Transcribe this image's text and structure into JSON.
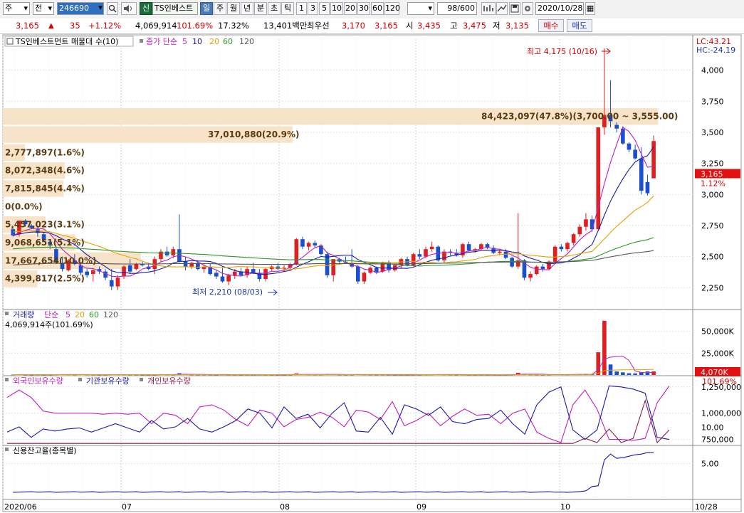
{
  "toolbar": {
    "market": "주",
    "adjust": "전",
    "code": "246690",
    "badge": "신",
    "name": "TS인베스트",
    "periods": [
      "일",
      "주",
      "월",
      "년",
      "분",
      "초",
      "틱"
    ],
    "active_period": "일",
    "counts": [
      "1",
      "3",
      "5",
      "10",
      "20",
      "30",
      "60",
      "120"
    ],
    "view": "98/600",
    "date": "2020/10/28"
  },
  "infobar": {
    "price": "3,165",
    "change": "35",
    "change_pct": "+1.12%",
    "volume": "4,069,914",
    "vol_ratio": "101.69%",
    "turnover": "17.32%",
    "amount": "13,401백만",
    "pref_label": "최우선",
    "ask": "3,170",
    "bid": "3,165",
    "open_label": "시",
    "open": "3,435",
    "high_label": "고",
    "high": "3,475",
    "low_label": "저",
    "low": "3,135",
    "buy_label": "매수",
    "sell_label": "매도"
  },
  "chart_data": {
    "type": "candlestick",
    "dates": [
      "2020/06",
      "07",
      "08",
      "09",
      "10",
      "10/28"
    ],
    "price": {
      "title": "TS인베스트먼트 매물대 수(10)",
      "ma_title": "종가 단순",
      "ma_periods": [
        "5",
        "10",
        "20",
        "60",
        "120"
      ],
      "ma_colors": [
        "#c020c0",
        "#1a1aa8",
        "#e8a000",
        "#2a9a2a",
        "#555555"
      ],
      "ylim": [
        2080,
        4250
      ],
      "yticks": [
        2250,
        2500,
        2750,
        3000,
        3250,
        3500,
        3750,
        4000
      ],
      "ytick_labels": [
        "2,250",
        "2,500",
        "2,750",
        "3,000",
        "3,250",
        "3,500",
        "3,750",
        "4,000"
      ],
      "lc": "LC:43.21",
      "hc": "HC:-24.19",
      "last_price": "3,165",
      "last_pct": "1.12%",
      "high_note": "최고 4,175 (10/16)",
      "low_note": "최저 2,210 (08/03)",
      "volume_profile": [
        {
          "label": "84,423,097(47.8%)(3,700.00 ~ 3,555.00)",
          "lo": 3555,
          "hi": 3700,
          "frac": 0.95
        },
        {
          "label": "37,010,880(20.9%)",
          "lo": 3410,
          "hi": 3555,
          "frac": 0.42
        },
        {
          "label": "2,777,897(1.6%)",
          "lo": 3265,
          "hi": 3410,
          "frac": 0.032
        },
        {
          "label": "8,072,348(4.6%)",
          "lo": 3120,
          "hi": 3265,
          "frac": 0.09
        },
        {
          "label": "7,815,845(4.4%)",
          "lo": 2975,
          "hi": 3120,
          "frac": 0.088
        },
        {
          "label": "0(0.0%)",
          "lo": 2830,
          "hi": 2975,
          "frac": 0.0
        },
        {
          "label": "5,457,023(3.1%)",
          "lo": 2685,
          "hi": 2830,
          "frac": 0.062
        },
        {
          "label": "9,068,651(5.1%)",
          "lo": 2540,
          "hi": 2685,
          "frac": 0.105
        },
        {
          "label": "17,667,654(10.0%)",
          "lo": 2395,
          "hi": 2540,
          "frac": 0.2
        },
        {
          "label": "4,399,817(2.5%)",
          "lo": 2250,
          "hi": 2395,
          "frac": 0.05
        }
      ],
      "candles": [
        [
          2720,
          2730,
          2660,
          2670
        ],
        [
          2680,
          2790,
          2660,
          2790
        ],
        [
          2790,
          2800,
          2740,
          2760
        ],
        [
          2750,
          2760,
          2720,
          2730
        ],
        [
          2720,
          2740,
          2660,
          2690
        ],
        [
          2680,
          2690,
          2620,
          2640
        ],
        [
          2620,
          2640,
          2560,
          2600
        ],
        [
          2560,
          2580,
          2440,
          2460
        ],
        [
          2450,
          2500,
          2380,
          2400
        ],
        [
          2390,
          2480,
          2380,
          2470
        ],
        [
          2470,
          2520,
          2430,
          2440
        ],
        [
          2430,
          2450,
          2350,
          2370
        ],
        [
          2380,
          2400,
          2330,
          2350
        ],
        [
          2360,
          2400,
          2300,
          2390
        ],
        [
          2400,
          2420,
          2360,
          2380
        ],
        [
          2380,
          2400,
          2310,
          2330
        ],
        [
          2310,
          2400,
          2230,
          2260
        ],
        [
          2260,
          2350,
          2230,
          2330
        ],
        [
          2340,
          2430,
          2320,
          2420
        ],
        [
          2430,
          2480,
          2360,
          2380
        ],
        [
          2400,
          2450,
          2390,
          2440
        ],
        [
          2440,
          2460,
          2420,
          2430
        ],
        [
          2420,
          2450,
          2390,
          2400
        ],
        [
          2400,
          2500,
          2360,
          2480
        ],
        [
          2480,
          2560,
          2460,
          2540
        ],
        [
          2540,
          2580,
          2500,
          2510
        ],
        [
          2510,
          2580,
          2490,
          2560
        ],
        [
          2560,
          2840,
          2450,
          2460
        ],
        [
          2460,
          2500,
          2390,
          2420
        ],
        [
          2420,
          2460,
          2400,
          2450
        ],
        [
          2450,
          2470,
          2390,
          2400
        ],
        [
          2400,
          2440,
          2370,
          2420
        ],
        [
          2420,
          2440,
          2350,
          2360
        ],
        [
          2370,
          2390,
          2320,
          2340
        ],
        [
          2340,
          2410,
          2290,
          2300
        ],
        [
          2300,
          2360,
          2270,
          2350
        ],
        [
          2350,
          2400,
          2320,
          2380
        ],
        [
          2380,
          2410,
          2340,
          2350
        ],
        [
          2350,
          2420,
          2330,
          2400
        ],
        [
          2400,
          2450,
          2360,
          2370
        ],
        [
          2370,
          2400,
          2300,
          2320
        ],
        [
          2320,
          2410,
          2300,
          2400
        ],
        [
          2400,
          2430,
          2380,
          2420
        ],
        [
          2420,
          2450,
          2390,
          2400
        ],
        [
          2400,
          2430,
          2380,
          2410
        ],
        [
          2410,
          2450,
          2390,
          2440
        ],
        [
          2440,
          2650,
          2430,
          2640
        ],
        [
          2640,
          2660,
          2560,
          2580
        ],
        [
          2580,
          2620,
          2550,
          2610
        ],
        [
          2610,
          2630,
          2570,
          2590
        ],
        [
          2590,
          2600,
          2510,
          2520
        ],
        [
          2520,
          2540,
          2330,
          2350
        ],
        [
          2350,
          2480,
          2300,
          2480
        ],
        [
          2480,
          2490,
          2440,
          2460
        ],
        [
          2460,
          2500,
          2440,
          2450
        ],
        [
          2450,
          2560,
          2410,
          2420
        ],
        [
          2420,
          2430,
          2280,
          2300
        ],
        [
          2300,
          2380,
          2280,
          2370
        ],
        [
          2370,
          2420,
          2360,
          2410
        ],
        [
          2410,
          2420,
          2360,
          2370
        ],
        [
          2380,
          2460,
          2370,
          2450
        ],
        [
          2450,
          2470,
          2370,
          2390
        ],
        [
          2390,
          2440,
          2380,
          2430
        ],
        [
          2430,
          2490,
          2410,
          2480
        ],
        [
          2480,
          2500,
          2420,
          2430
        ],
        [
          2430,
          2530,
          2420,
          2520
        ],
        [
          2520,
          2560,
          2480,
          2500
        ],
        [
          2500,
          2580,
          2490,
          2560
        ],
        [
          2560,
          2620,
          2540,
          2580
        ],
        [
          2580,
          2590,
          2460,
          2470
        ],
        [
          2470,
          2560,
          2450,
          2540
        ],
        [
          2540,
          2560,
          2510,
          2530
        ],
        [
          2530,
          2560,
          2500,
          2510
        ],
        [
          2510,
          2610,
          2490,
          2600
        ],
        [
          2600,
          2620,
          2540,
          2550
        ],
        [
          2550,
          2570,
          2530,
          2560
        ],
        [
          2560,
          2610,
          2550,
          2600
        ],
        [
          2600,
          2610,
          2560,
          2570
        ],
        [
          2570,
          2590,
          2520,
          2530
        ],
        [
          2530,
          2550,
          2510,
          2540
        ],
        [
          2540,
          2560,
          2480,
          2490
        ],
        [
          2490,
          2500,
          2410,
          2420
        ],
        [
          2420,
          2850,
          2400,
          2470
        ],
        [
          2470,
          2480,
          2310,
          2330
        ],
        [
          2330,
          2380,
          2300,
          2360
        ],
        [
          2360,
          2430,
          2350,
          2420
        ],
        [
          2420,
          2440,
          2380,
          2400
        ],
        [
          2400,
          2470,
          2390,
          2460
        ],
        [
          2460,
          2590,
          2450,
          2580
        ],
        [
          2580,
          2600,
          2540,
          2560
        ],
        [
          2560,
          2620,
          2540,
          2610
        ],
        [
          2610,
          2690,
          2590,
          2680
        ],
        [
          2680,
          2760,
          2660,
          2740
        ],
        [
          2740,
          2850,
          2710,
          2800
        ],
        [
          2800,
          2830,
          2700,
          2720
        ],
        [
          2720,
          3540,
          2720,
          3540
        ],
        [
          3540,
          4175,
          3480,
          3640
        ],
        [
          3640,
          3920,
          3540,
          3590
        ],
        [
          3560,
          3580,
          3500,
          3530
        ],
        [
          3530,
          3550,
          3400,
          3410
        ],
        [
          3410,
          3420,
          3340,
          3360
        ],
        [
          3360,
          3400,
          3280,
          3290
        ],
        [
          3290,
          3380,
          3000,
          3030
        ],
        [
          3100,
          3160,
          2990,
          3010
        ],
        [
          3130,
          3475,
          3135,
          3430
        ]
      ]
    },
    "volume": {
      "title": "거래량",
      "ma_title": "단순",
      "ma_periods": [
        "5",
        "20",
        "60",
        "120"
      ],
      "current": "4,069,914주(101.69%)",
      "ylim": [
        0,
        70000
      ],
      "yticks": [
        25000,
        50000
      ],
      "ytick_labels": [
        "25,000K",
        "50,000K"
      ],
      "last_label": "4,070K",
      "last_pct": "101.69%",
      "values": [
        300,
        500,
        250,
        200,
        400,
        250,
        300,
        600,
        700,
        400,
        300,
        500,
        400,
        300,
        250,
        300,
        700,
        400,
        400,
        300,
        250,
        200,
        250,
        300,
        900,
        400,
        300,
        2000,
        600,
        300,
        250,
        300,
        300,
        250,
        500,
        300,
        300,
        250,
        300,
        250,
        400,
        300,
        250,
        200,
        250,
        300,
        1800,
        600,
        400,
        350,
        300,
        1000,
        700,
        300,
        250,
        300,
        700,
        400,
        300,
        250,
        300,
        250,
        250,
        300,
        250,
        350,
        300,
        400,
        500,
        800,
        400,
        300,
        250,
        400,
        300,
        250,
        300,
        250,
        250,
        300,
        300,
        400,
        2500,
        800,
        400,
        300,
        300,
        300,
        800,
        400,
        400,
        600,
        900,
        1200,
        800,
        26000,
        62000,
        12000,
        4000,
        3000,
        2000,
        1800,
        3000,
        4000,
        4070
      ]
    },
    "holdings": {
      "series": [
        "외국인보유수량",
        "기관보유수량",
        "개인보유수량"
      ],
      "colors": [
        "#c020c0",
        "#1a1aa8",
        "#8a1a4a"
      ],
      "yticks": [
        750000,
        1000000,
        1250000
      ],
      "ytick_labels": [
        "750,000",
        "1,000,000",
        "1,250,000"
      ],
      "ylim": [
        700000,
        1330000
      ]
    },
    "credit": {
      "title": "신용잔고율(종목별)",
      "yticks": [
        5,
        10
      ],
      "ytick_labels": [
        "5.00",
        "10.00"
      ],
      "ylim": [
        0,
        7.5
      ]
    }
  }
}
